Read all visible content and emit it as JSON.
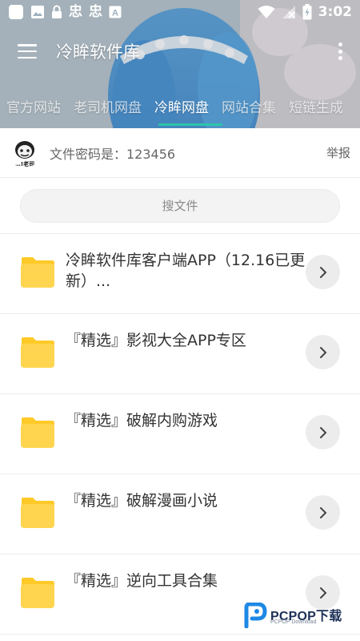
{
  "status_bar": {
    "time": "3:02",
    "glyph_a": "忠",
    "glyph_b": "忠",
    "glyph_letter": "A"
  },
  "toolbar": {
    "title": "冷眸软件库"
  },
  "tabs": [
    {
      "label": "官方网站",
      "active": false
    },
    {
      "label": "老司机网盘",
      "active": false
    },
    {
      "label": "冷眸网盘",
      "active": true
    },
    {
      "label": "网站合集",
      "active": false
    },
    {
      "label": "短链生成",
      "active": false
    }
  ],
  "notice": {
    "text": "文件密码是：123456",
    "report_label": "举报",
    "avatar_caption": "…!老司"
  },
  "search": {
    "label": "搜文件"
  },
  "items": [
    {
      "title": "冷眸软件库客户端APP（12.16已更新）..."
    },
    {
      "title": "『精选』影视大全APP专区"
    },
    {
      "title": "『精选』破解内购游戏"
    },
    {
      "title": "『精选』破解漫画小说"
    },
    {
      "title": "『精选』逆向工具合集"
    }
  ],
  "watermark": {
    "brand": "PCPOP下载",
    "sub": "PCPOP Download"
  },
  "colors": {
    "accent": "#2ec4a9",
    "folder": "#ffd54f",
    "folder_tab": "#ffca28",
    "chevron_bg": "#ececec"
  },
  "icons": [
    "menu-icon",
    "more-icon",
    "wifi-icon",
    "battery-icon",
    "folder-icon",
    "chevron-right-icon"
  ]
}
